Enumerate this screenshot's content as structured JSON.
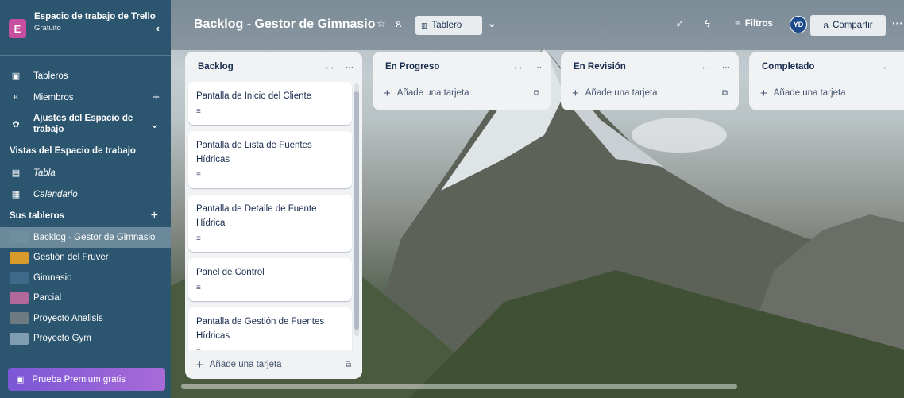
{
  "workspace": {
    "avatar_letter": "E",
    "name": "Espacio de trabajo de Trello",
    "plan": "Gratuito",
    "collapse_icon": "chevron-left-icon"
  },
  "sidebar": {
    "nav": [
      {
        "label": "Tableros",
        "icon": "board-icon"
      },
      {
        "label": "Miembros",
        "icon": "members-icon",
        "action": "+"
      },
      {
        "label": "Ajustes del Espacio de trabajo",
        "icon": "gear-icon",
        "action": "⌄"
      }
    ],
    "views_title": "Vistas del Espacio de trabajo",
    "views": [
      {
        "label": "Tabla",
        "icon": "table-icon"
      },
      {
        "label": "Calendario",
        "icon": "calendar-icon"
      }
    ],
    "boards_title": "Sus tableros",
    "boards_add": "+",
    "boards": [
      {
        "label": "Backlog - Gestor de Gimnasio",
        "color": "#6f8fa0",
        "active": true
      },
      {
        "label": "Gestión del Fruver",
        "color": "#d89a2a"
      },
      {
        "label": "Gimnasio",
        "color": "#3e6a8a"
      },
      {
        "label": "Parcial",
        "color": "#b0679a"
      },
      {
        "label": "Proyecto Analisis",
        "color": "#6d7a80"
      },
      {
        "label": "Proyecto Gym",
        "color": "#7f9cb0"
      }
    ],
    "premium_label": "Prueba Premium gratis"
  },
  "topbar": {
    "board_title": "Backlog - Gestor de Gimnasio",
    "view_label": "Tablero",
    "filters_label": "Filtros",
    "avatar_initials": "YD",
    "share_label": "Compartir"
  },
  "lists": [
    {
      "title": "Backlog",
      "cards": [
        "Pantalla de Inicio del Cliente",
        "Pantalla de Lista de Fuentes Hídricas",
        "Pantalla de Detalle de Fuente Hídrica",
        "Panel de Control",
        "Pantalla de Gestión de Fuentes Hídricas"
      ],
      "add_label": "Añade una tarjeta"
    },
    {
      "title": "En Progreso",
      "cards": [],
      "add_label": "Añade una tarjeta"
    },
    {
      "title": "En Revisión",
      "cards": [],
      "add_label": "Añade una tarjeta"
    },
    {
      "title": "Completado",
      "cards": [],
      "add_label": "Añade una tarjeta"
    }
  ]
}
